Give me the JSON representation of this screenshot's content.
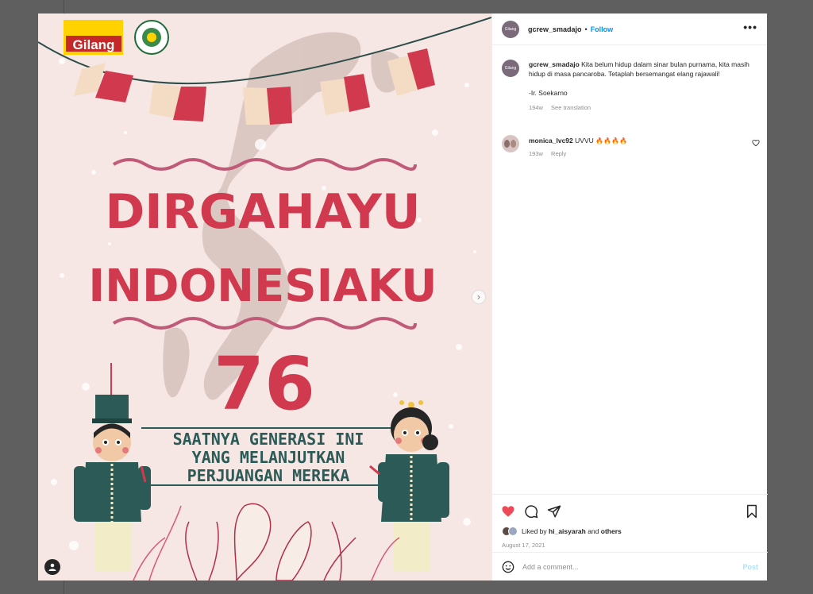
{
  "post": {
    "username": "gcrew_smadajo",
    "avatar_text": "Gilang",
    "follow_label": "Follow",
    "more_label": "•••",
    "separator": "•",
    "caption": "Kita belum hidup dalam sinar bulan purnama, kita masih hidup di masa pancaroba. Tetaplah bersemangat elang rajawali!",
    "caption_signature": "-Ir. Soekarno",
    "caption_age": "194w",
    "see_translation": "See translation",
    "liked_by_prefix": "Liked by",
    "liked_by_user": "hi_aisyarah",
    "liked_by_and": "and",
    "liked_by_others": "others",
    "date": "August 17, 2021"
  },
  "comments": [
    {
      "username": "monica_lvc92",
      "text": "UVVU",
      "emoji": "🔥🔥🔥🔥",
      "age": "193w",
      "reply_label": "Reply"
    }
  ],
  "composer": {
    "placeholder": "Add a comment...",
    "post_label": "Post"
  },
  "image": {
    "logo_text": "Gilang",
    "title_line1": "DIRGAHAYU",
    "title_line2": "INDONESIAKU",
    "number": "76",
    "subtitle_line1": "SAATNYA GENERASI INI",
    "subtitle_line2": "YANG MELANJUTKAN",
    "subtitle_line3": "PERJUANGAN MEREKA"
  },
  "colors": {
    "accent_red": "#d13a4e",
    "teal": "#2c5a57",
    "link_blue": "#0095f6",
    "like_red": "#ed4956",
    "poster_bg": "#f6e6e4"
  },
  "icons": [
    "heart-icon",
    "comment-icon",
    "share-icon",
    "bookmark-icon",
    "more-icon",
    "emoji-icon",
    "chevron-right-icon",
    "user-tag-icon"
  ]
}
